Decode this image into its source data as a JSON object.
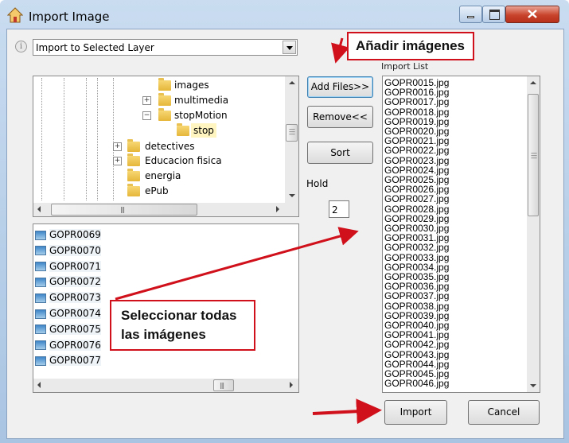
{
  "window": {
    "title": "Import Image"
  },
  "combo": {
    "value": "Import to Selected Layer"
  },
  "tree": {
    "items": [
      {
        "label": "images",
        "expander": ""
      },
      {
        "label": "multimedia",
        "expander": "+"
      },
      {
        "label": "stopMotion",
        "expander": "−"
      },
      {
        "label": "stop",
        "expander": ""
      },
      {
        "label": "detectives",
        "expander": "+"
      },
      {
        "label": "Educacion fisica",
        "expander": "+"
      },
      {
        "label": "energia",
        "expander": ""
      },
      {
        "label": "ePub",
        "expander": ""
      }
    ]
  },
  "files": [
    "GOPR0069",
    "GOPR0070",
    "GOPR0071",
    "GOPR0072",
    "GOPR0073",
    "GOPR0074",
    "GOPR0075",
    "GOPR0076",
    "GOPR0077"
  ],
  "buttons": {
    "add": "Add Files>>",
    "remove": "Remove<<",
    "sort": "Sort",
    "import": "Import",
    "cancel": "Cancel"
  },
  "hold": {
    "label": "Hold",
    "value": "2"
  },
  "import_list": {
    "label": "Import List",
    "items": [
      "GOPR0015.jpg",
      "GOPR0016.jpg",
      "GOPR0017.jpg",
      "GOPR0018.jpg",
      "GOPR0019.jpg",
      "GOPR0020.jpg",
      "GOPR0021.jpg",
      "GOPR0022.jpg",
      "GOPR0023.jpg",
      "GOPR0024.jpg",
      "GOPR0025.jpg",
      "GOPR0026.jpg",
      "GOPR0027.jpg",
      "GOPR0028.jpg",
      "GOPR0029.jpg",
      "GOPR0030.jpg",
      "GOPR0031.jpg",
      "GOPR0032.jpg",
      "GOPR0033.jpg",
      "GOPR0034.jpg",
      "GOPR0035.jpg",
      "GOPR0036.jpg",
      "GOPR0037.jpg",
      "GOPR0038.jpg",
      "GOPR0039.jpg",
      "GOPR0040.jpg",
      "GOPR0041.jpg",
      "GOPR0042.jpg",
      "GOPR0043.jpg",
      "GOPR0044.jpg",
      "GOPR0045.jpg",
      "GOPR0046.jpg"
    ]
  },
  "annotations": {
    "add_images": "Añadir imágenes",
    "select_line1": "Seleccionar todas",
    "select_line2": "las imágenes"
  },
  "colors": {
    "annotation_red": "#d0101b",
    "selection": "#fff5c0"
  }
}
